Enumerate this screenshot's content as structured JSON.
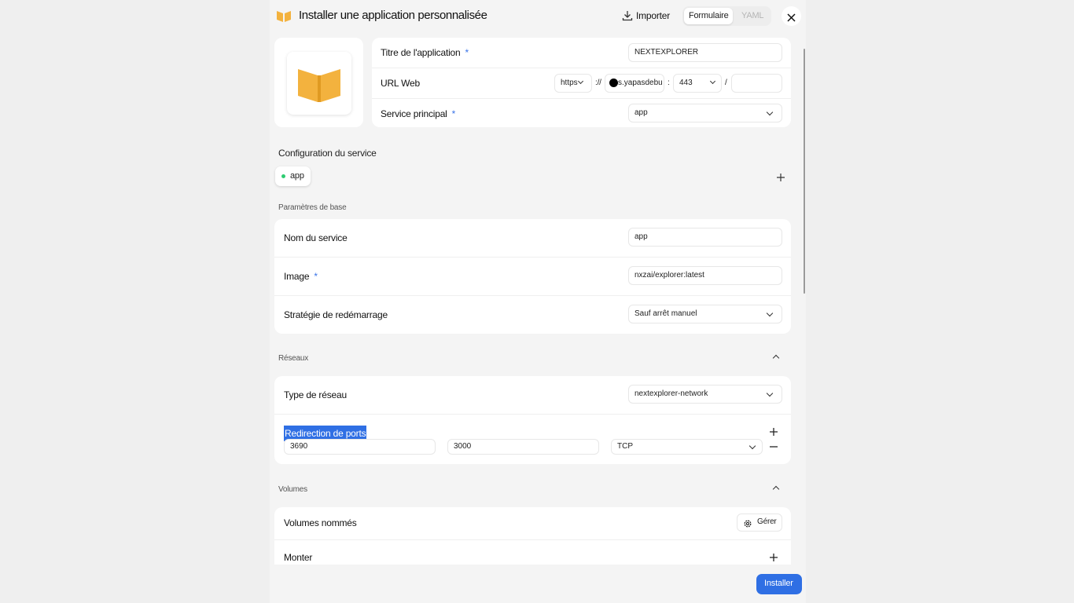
{
  "header": {
    "title": "Installer une application personnalisée",
    "import_label": "Importer",
    "tabs": [
      {
        "label": "Formulaire",
        "active": true
      },
      {
        "label": "YAML",
        "active": false
      }
    ],
    "icons": {
      "app": "book-open-icon",
      "import": "download-icon",
      "close": "close-icon"
    }
  },
  "app_info": {
    "title_label": "Titre de l'application",
    "title_value": "NEXTEXPLORER",
    "url_label": "URL Web",
    "url_protocol": "https",
    "url_separator": "://",
    "url_host": "s.yapasdebu",
    "url_port_separator": ":",
    "url_port": "443",
    "url_path_separator": "/",
    "url_path": "",
    "service_label": "Service principal",
    "service_value": "app",
    "required_mark": "*"
  },
  "service_config": {
    "heading": "Configuration du service",
    "services": [
      {
        "name": "app",
        "status_color": "#2ecc71"
      }
    ]
  },
  "basic_params": {
    "heading": "Paramètres de base",
    "service_name_label": "Nom du service",
    "service_name_value": "app",
    "image_label": "Image",
    "image_value": "nxzai/explorer:latest",
    "restart_label": "Stratégie de redémarrage",
    "restart_value": "Sauf arrêt manuel"
  },
  "networks": {
    "heading": "Réseaux",
    "type_label": "Type de réseau",
    "type_value": "nextexplorer-network",
    "port_label": "Redirection de ports",
    "ports": [
      {
        "host": "3690",
        "container": "3000",
        "protocol": "TCP"
      }
    ]
  },
  "volumes": {
    "heading": "Volumes",
    "named_label": "Volumes nommés",
    "manage_label": "Gérer",
    "mount_label": "Monter"
  },
  "footer": {
    "install_label": "Installer"
  },
  "colors": {
    "accent": "#2f6fe4",
    "required": "#3a74e8",
    "status_dot": "#2ecc71",
    "selection": "#2f6fe4",
    "logo": "#f3b23e"
  }
}
